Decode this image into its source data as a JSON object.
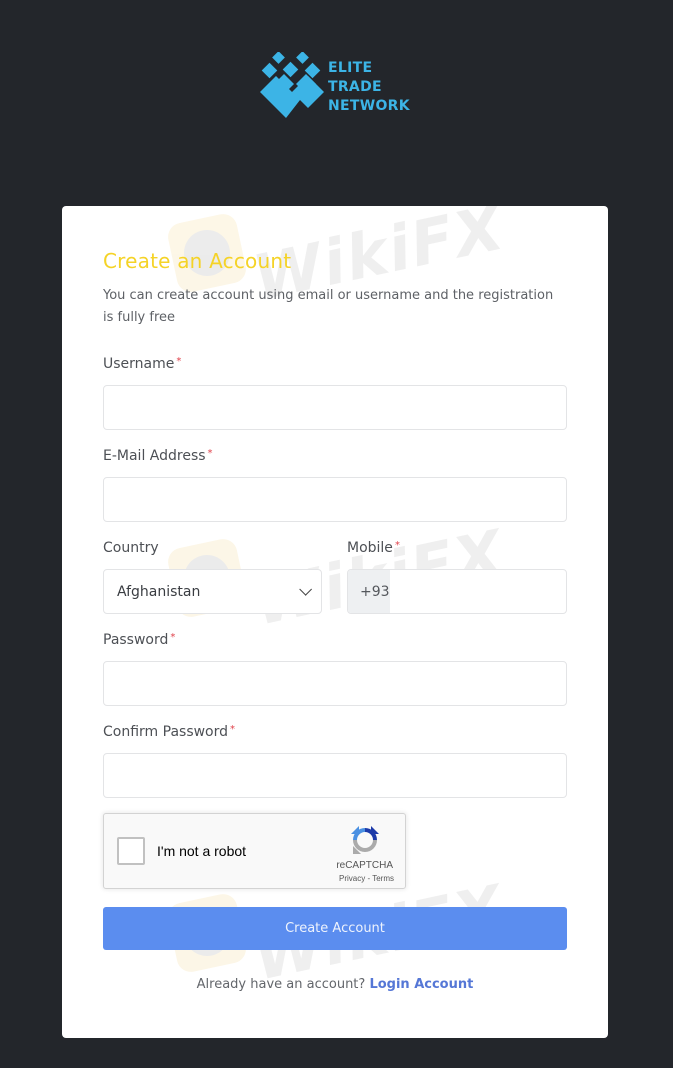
{
  "brand": {
    "name_lines": [
      "ELITE",
      "TRADE",
      "NETWORK"
    ],
    "color": "#3cb4e6",
    "logo_icon": "diamond-grid-logo-icon"
  },
  "form": {
    "title": "Create an Account",
    "subtitle": "You can create account using email or username and the registration is fully free",
    "title_color": "#f5d327",
    "required_marker": "*",
    "fields": {
      "username": {
        "label": "Username",
        "required": true,
        "value": "",
        "placeholder": ""
      },
      "email": {
        "label": "E-Mail Address",
        "required": true,
        "value": "",
        "placeholder": ""
      },
      "country": {
        "label": "Country",
        "required": false,
        "selected": "Afghanistan",
        "icon": "chevron-down-icon"
      },
      "mobile": {
        "label": "Mobile",
        "required": true,
        "prefix": "+93",
        "value": "",
        "placeholder": ""
      },
      "password": {
        "label": "Password",
        "required": true,
        "value": "",
        "placeholder": ""
      },
      "confirm_password": {
        "label": "Confirm Password",
        "required": true,
        "value": "",
        "placeholder": ""
      }
    },
    "captcha": {
      "label": "I'm not a robot",
      "checked": false,
      "brand": "reCAPTCHA",
      "privacy": "Privacy",
      "separator": " - ",
      "terms": "Terms",
      "icon": "recaptcha-icon"
    },
    "submit_label": "Create Account",
    "submit_color": "#5b8def",
    "login_prompt": "Already have an account?",
    "login_link": "Login Account"
  },
  "watermark": {
    "text": "WikiFX"
  }
}
